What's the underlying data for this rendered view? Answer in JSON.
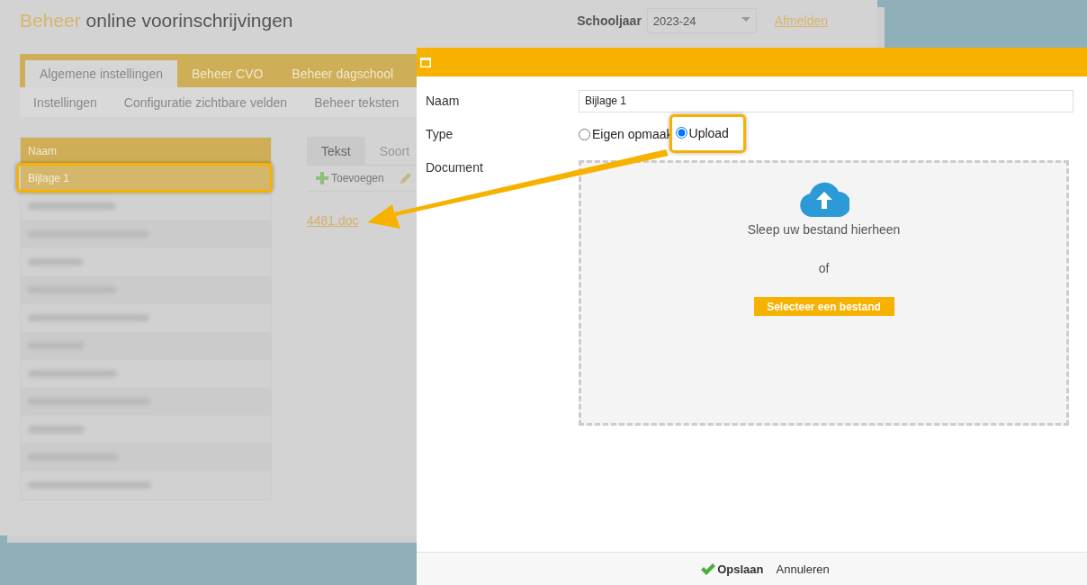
{
  "header": {
    "title_accent": "Beheer",
    "title_rest": "online voorinschrijvingen",
    "year_label": "Schooljaar",
    "year_value": "2023-24",
    "logout": "Afmelden"
  },
  "tabs": [
    {
      "label": "Algemene instellingen",
      "selected": true
    },
    {
      "label": "Beheer CVO",
      "selected": false
    },
    {
      "label": "Beheer dagschool",
      "selected": false
    }
  ],
  "subtabs": [
    "Instellingen",
    "Configuratie zichtbare velden",
    "Beheer teksten"
  ],
  "grid": {
    "column": "Naam",
    "rows": [
      {
        "kind": "text",
        "label": "Bijlage 1",
        "selected": true,
        "highlighted": true
      },
      {
        "kind": "redacted"
      },
      {
        "kind": "redacted"
      },
      {
        "kind": "redacted"
      },
      {
        "kind": "redacted"
      },
      {
        "kind": "redacted"
      },
      {
        "kind": "redacted"
      },
      {
        "kind": "redacted"
      },
      {
        "kind": "redacted"
      },
      {
        "kind": "redacted"
      },
      {
        "kind": "redacted"
      },
      {
        "kind": "redacted"
      }
    ]
  },
  "detail": {
    "tabs": [
      {
        "label": "Tekst",
        "selected": true
      },
      {
        "label": "Soort",
        "selected": false
      }
    ],
    "add": "Toevoegen",
    "file_link": "4481.doc"
  },
  "dialog": {
    "name_label": "Naam",
    "name_value": "Bijlage 1",
    "type_label": "Type",
    "type_options": [
      {
        "label": "Eigen opmaak",
        "selected": false,
        "highlighted": false
      },
      {
        "label": "Upload",
        "selected": true,
        "highlighted": true
      }
    ],
    "document_label": "Document",
    "drop_text": "Sleep uw bestand hierheen",
    "or_text": "of",
    "select_button": "Selecteer een bestand",
    "save": "Opslaan",
    "cancel": "Annuleren"
  }
}
